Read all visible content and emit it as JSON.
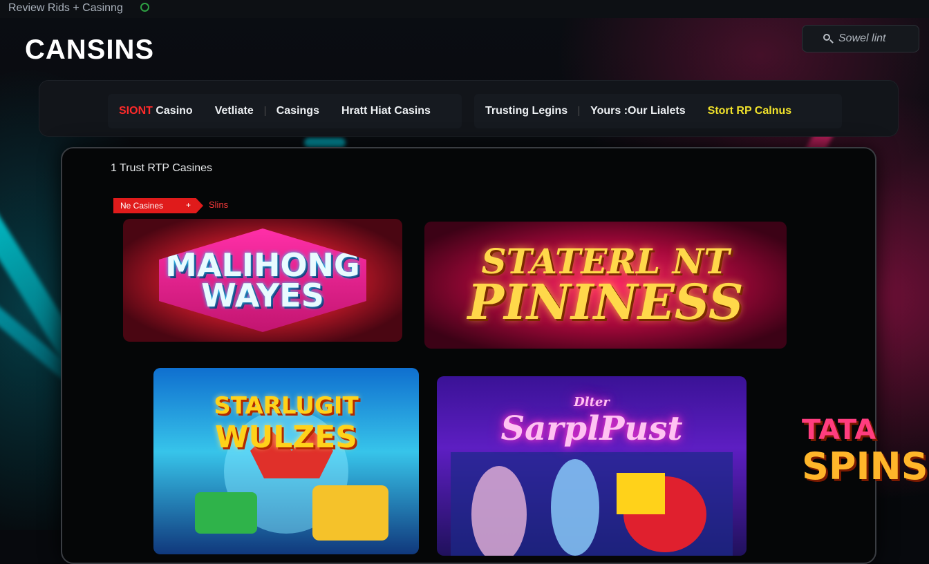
{
  "browser": {
    "tab_title": "Review Rids + Casinng"
  },
  "site": {
    "logo": "CANSINS"
  },
  "search": {
    "placeholder": "Sowel lint"
  },
  "nav": {
    "group1": [
      {
        "prefix": "SIONT",
        "label": "Casino"
      },
      {
        "label": "Vetliate"
      },
      {
        "label": "Casings"
      },
      {
        "label": "Hratt Hiat Casins"
      }
    ],
    "group2": [
      {
        "label": "Trusting Legins"
      },
      {
        "label": "Yours :Our Lialets"
      },
      {
        "label": "Stort RP Calnus"
      }
    ]
  },
  "panel": {
    "title": "1 Trust RTP Casines",
    "filter_tag": "Ne Casines",
    "filter_tag_icon": "+",
    "filter_alt": "Slins"
  },
  "games": [
    {
      "line1": "MALIHONG",
      "line2": "WAYES"
    },
    {
      "line1": "STATERL NT",
      "line2": "PININESS"
    },
    {
      "line1": "STARLUGIT",
      "line2": "WULZES"
    },
    {
      "line1": "Dlter",
      "line2": "SarplPust"
    }
  ],
  "side_logo": {
    "line1": "TATA",
    "line2": "SPINS"
  },
  "colors": {
    "nav_accent": "#f1e22b",
    "brand_red": "#e01b1b"
  }
}
